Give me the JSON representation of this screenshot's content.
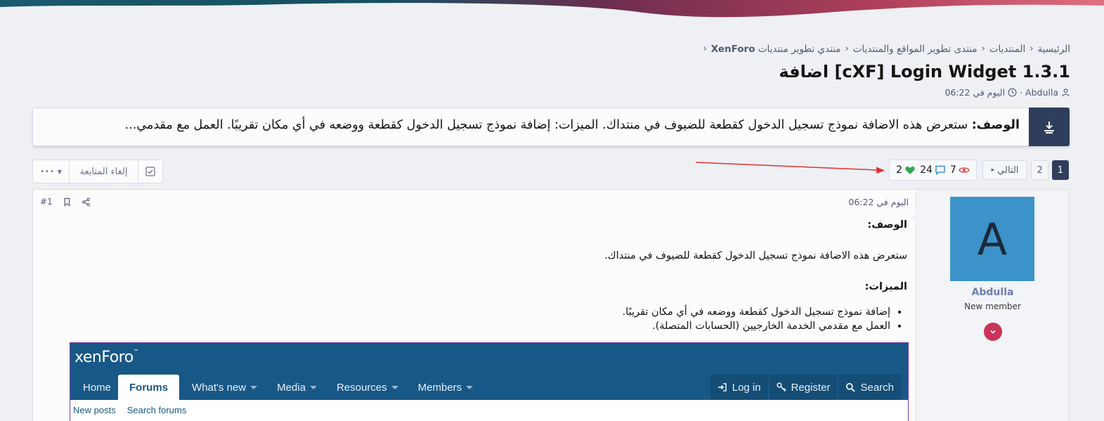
{
  "breadcrumb": {
    "items": [
      "الرئيسية",
      "المنتديات",
      "منتدى تطوير المواقع والمنتديات",
      "منتدي تطوير منتديات XenForo"
    ],
    "xf_word": "XenForo"
  },
  "thread": {
    "title": "اضافة [cXF] Login Widget 1.3.1",
    "author": "Abdulla",
    "date": "اليوم في 06:22",
    "sep": "·"
  },
  "description": {
    "label": "الوصف:",
    "text": " ستعرض هذه الاضافة نموذج تسجيل الدخول كقطعة للضيوف في منتداك. الميزات: إضافة نموذج تسجيل الدخول كقطعة ووضعه في أي مكان تقريبًا. العمل مع مقدمي..."
  },
  "pagination": {
    "pages": [
      "1",
      "2"
    ],
    "active": "1",
    "next_label": "التالي"
  },
  "stats": {
    "views": "7",
    "replies": "24",
    "likes": "2",
    "view_color": "#d9534f",
    "reply_color": "#3c93c9",
    "like_color": "#2fa84f"
  },
  "actions": {
    "unwatch_label": "إلغاء المتابعة",
    "more_label": "•••"
  },
  "post": {
    "number": "#1",
    "date": "اليوم في 06:22",
    "body": {
      "desc_heading": "الوصف:",
      "desc_text": "ستعرض هذه الاضافة نموذج تسجيل الدخول كقطعة للضيوف في منتداك.",
      "features_heading": "الميزات:",
      "features": [
        "إضافة نموذج تسجيل الدخول كقطعة ووضعه في أي مكان تقريبًا.",
        "العمل مع مقدمي الخدمة الخارجيين (الحسابات المتصلة)."
      ]
    },
    "user": {
      "avatar_letter": "A",
      "name": "Abdulla",
      "title": "New member"
    }
  },
  "xenforo_screenshot": {
    "logo_a": "xen",
    "logo_b": "Foro",
    "nav": [
      "Home",
      "Forums",
      "What's new",
      "Media",
      "Resources",
      "Members"
    ],
    "login": "Log in",
    "register": "Register",
    "search": "Search",
    "sub": [
      "New posts",
      "Search forums"
    ]
  }
}
